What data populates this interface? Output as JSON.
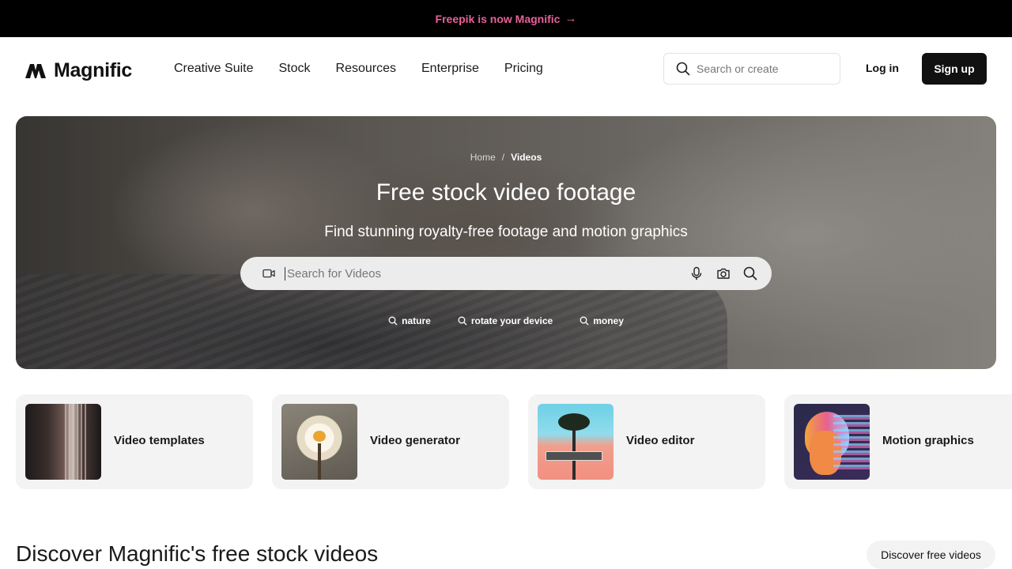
{
  "promo": {
    "text": "Freepik is now Magnific",
    "arrow": "→",
    "color": "#e8609a"
  },
  "header": {
    "logo_text": "Magnific",
    "nav": [
      "Creative Suite",
      "Stock",
      "Resources",
      "Enterprise",
      "Pricing"
    ],
    "search_placeholder": "Search or create",
    "login_label": "Log in",
    "signup_label": "Sign up"
  },
  "hero": {
    "breadcrumb": {
      "home": "Home",
      "sep": "/",
      "current": "Videos"
    },
    "title": "Free stock video footage",
    "subtitle": "Find stunning royalty-free footage and motion graphics",
    "search_placeholder": "Search for Videos",
    "tags": [
      "nature",
      "rotate your device",
      "money"
    ]
  },
  "cards": [
    {
      "label": "Video templates",
      "icon": "video-templates-thumbnail"
    },
    {
      "label": "Video generator",
      "icon": "video-generator-thumbnail"
    },
    {
      "label": "Video editor",
      "icon": "video-editor-thumbnail"
    },
    {
      "label": "Motion graphics",
      "icon": "motion-graphics-thumbnail"
    }
  ],
  "discover": {
    "title": "Discover Magnific's free stock videos",
    "button_label": "Discover free videos"
  }
}
